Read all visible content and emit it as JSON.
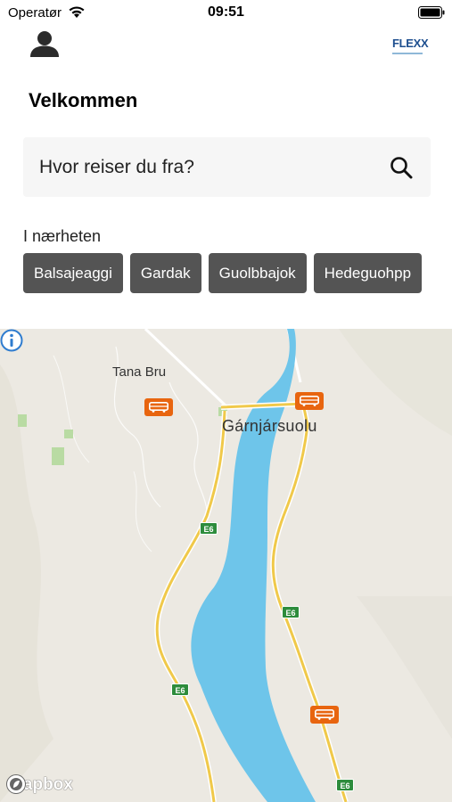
{
  "status_bar": {
    "carrier": "Operatør",
    "time": "09:51"
  },
  "header": {
    "logo_text": "FLEXX",
    "profile_icon": "person-icon"
  },
  "title": "Velkommen",
  "search": {
    "placeholder": "Hvor reiser du fra?",
    "icon": "search-icon"
  },
  "nearby": {
    "label": "I nærheten",
    "chips": [
      "Balsajeaggi",
      "Gardak",
      "Guolbbajok",
      "Hedeguohpp"
    ]
  },
  "map": {
    "labels": {
      "town": "Tana Bru",
      "place": "Gárnjársuolu"
    },
    "road_shields": [
      "E6",
      "E6",
      "E6",
      "E6"
    ],
    "attribution": "mapbox",
    "colors": {
      "water": "#6ec5ea",
      "road": "#f0c94a",
      "land": "#ece9e2",
      "bus_marker": "#e8650f",
      "shield": "#2d8c3c"
    }
  }
}
